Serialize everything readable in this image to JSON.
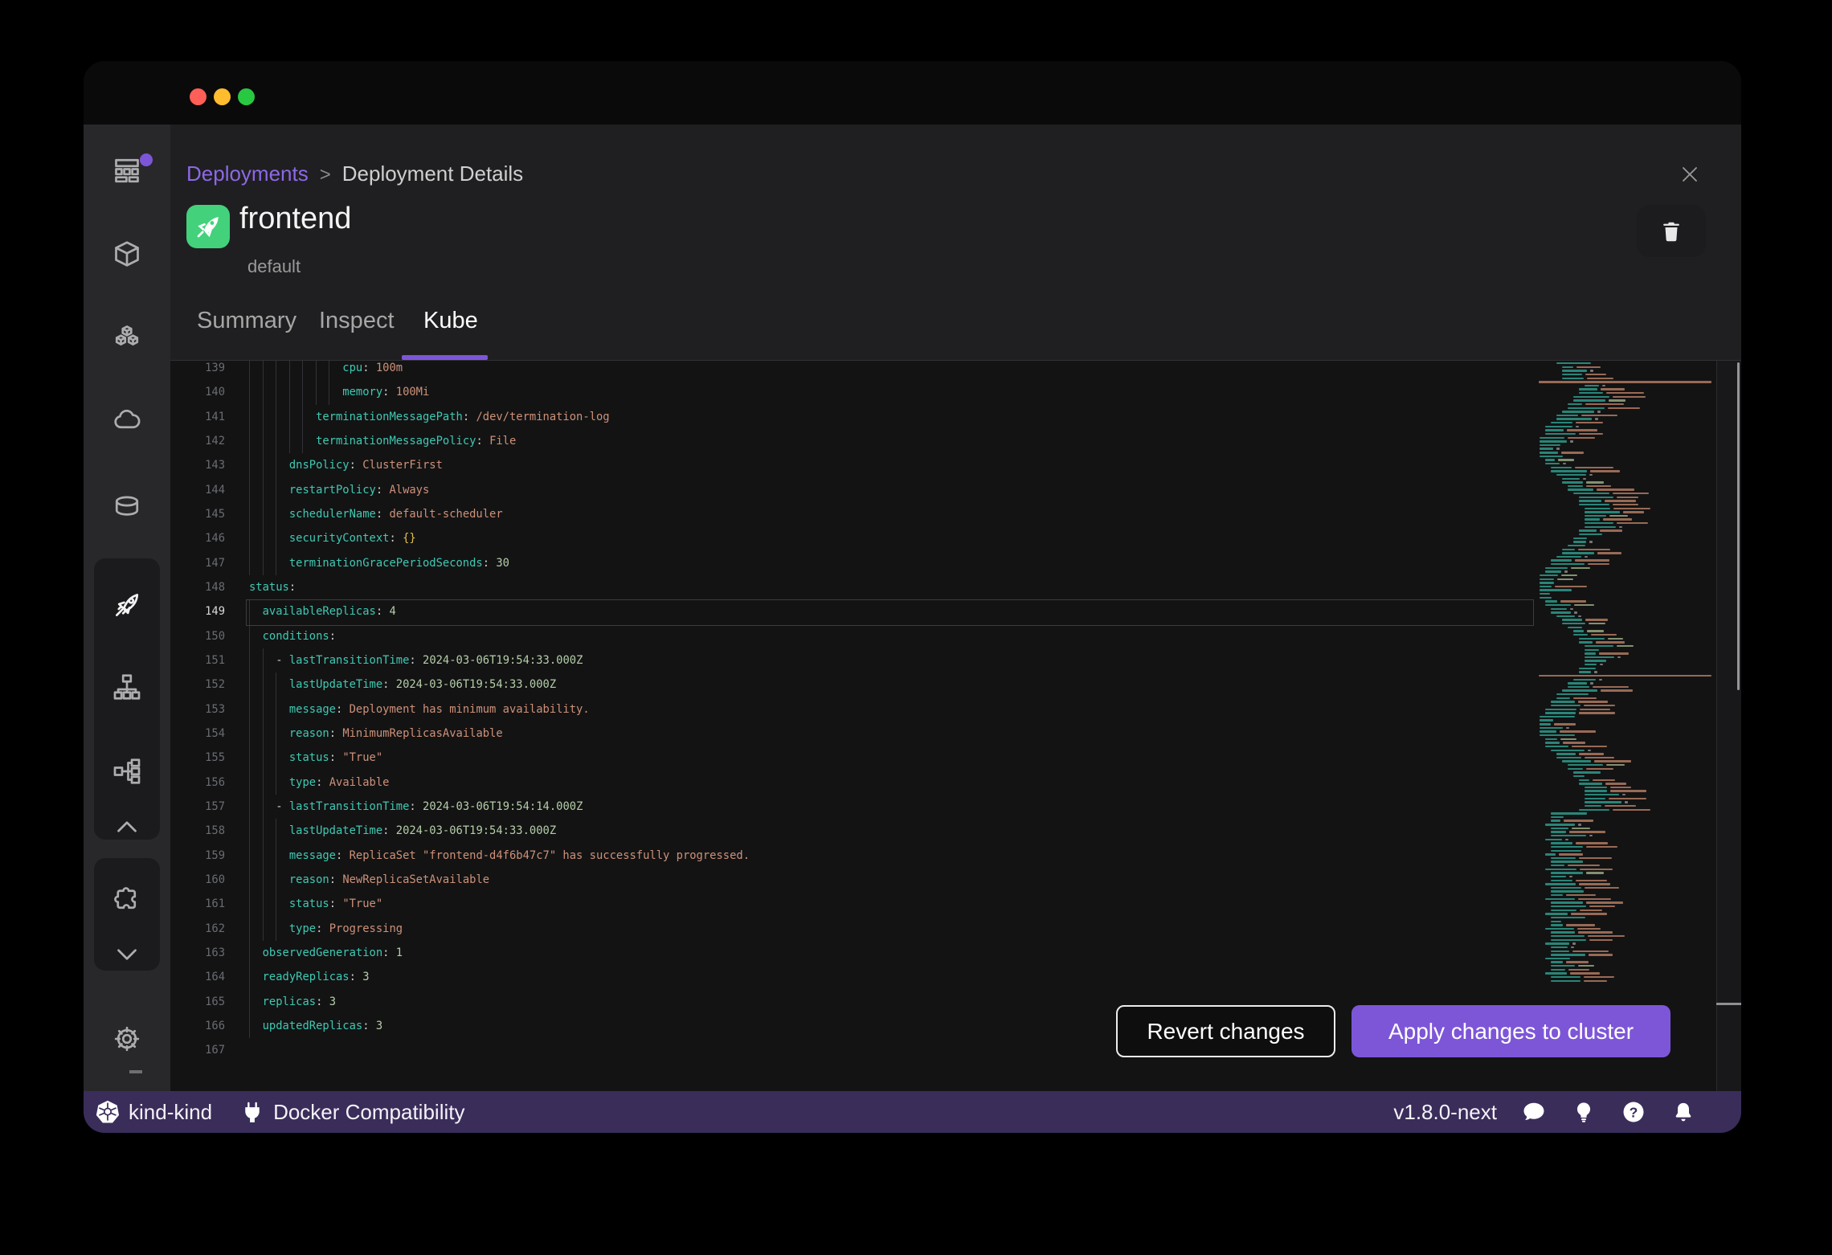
{
  "window": {
    "controls": [
      "close",
      "minimize",
      "zoom"
    ]
  },
  "header": {
    "breadcrumb": {
      "parent": "Deployments",
      "separator": ">",
      "current": "Deployment Details"
    },
    "title": "frontend",
    "namespace": "default",
    "tabs": [
      {
        "label": "Summary",
        "active": false
      },
      {
        "label": "Inspect",
        "active": false
      },
      {
        "label": "Kube",
        "active": true
      }
    ]
  },
  "sidebar": {
    "items": [
      "dashboard",
      "containers",
      "pods",
      "images-cloud",
      "volumes",
      "deployments-rocket",
      "services-sitemap",
      "networking-workflow",
      "scroll-up",
      "extensions-puzzle",
      "scroll-down",
      "settings"
    ]
  },
  "editor": {
    "first_line": 139,
    "last_line": 167,
    "current_line": 149,
    "lines": [
      {
        "n": 139,
        "ind": 14,
        "seg": [
          [
            "k",
            "cpu"
          ],
          [
            "p",
            ": "
          ],
          [
            "s",
            "100m"
          ]
        ]
      },
      {
        "n": 140,
        "ind": 14,
        "seg": [
          [
            "k",
            "memory"
          ],
          [
            "p",
            ": "
          ],
          [
            "s",
            "100Mi"
          ]
        ]
      },
      {
        "n": 141,
        "ind": 10,
        "seg": [
          [
            "k",
            "terminationMessagePath"
          ],
          [
            "p",
            ": "
          ],
          [
            "s",
            "/dev/termination-log"
          ]
        ]
      },
      {
        "n": 142,
        "ind": 10,
        "seg": [
          [
            "k",
            "terminationMessagePolicy"
          ],
          [
            "p",
            ": "
          ],
          [
            "s",
            "File"
          ]
        ]
      },
      {
        "n": 143,
        "ind": 6,
        "seg": [
          [
            "k",
            "dnsPolicy"
          ],
          [
            "p",
            ": "
          ],
          [
            "s",
            "ClusterFirst"
          ]
        ]
      },
      {
        "n": 144,
        "ind": 6,
        "seg": [
          [
            "k",
            "restartPolicy"
          ],
          [
            "p",
            ": "
          ],
          [
            "s",
            "Always"
          ]
        ]
      },
      {
        "n": 145,
        "ind": 6,
        "seg": [
          [
            "k",
            "schedulerName"
          ],
          [
            "p",
            ": "
          ],
          [
            "s",
            "default-scheduler"
          ]
        ]
      },
      {
        "n": 146,
        "ind": 6,
        "seg": [
          [
            "k",
            "securityContext"
          ],
          [
            "p",
            ": "
          ],
          [
            "b",
            "{}"
          ]
        ]
      },
      {
        "n": 147,
        "ind": 6,
        "seg": [
          [
            "k",
            "terminationGracePeriodSeconds"
          ],
          [
            "p",
            ": "
          ],
          [
            "n",
            "30"
          ]
        ]
      },
      {
        "n": 148,
        "ind": 0,
        "seg": [
          [
            "k",
            "status"
          ],
          [
            "p",
            ":"
          ]
        ]
      },
      {
        "n": 149,
        "ind": 2,
        "seg": [
          [
            "k",
            "availableReplicas"
          ],
          [
            "p",
            ": "
          ],
          [
            "n",
            "4"
          ]
        ]
      },
      {
        "n": 150,
        "ind": 2,
        "seg": [
          [
            "k",
            "conditions"
          ],
          [
            "p",
            ":"
          ]
        ]
      },
      {
        "n": 151,
        "ind": 4,
        "seg": [
          [
            "p",
            "- "
          ],
          [
            "k",
            "lastTransitionTime"
          ],
          [
            "p",
            ": "
          ],
          [
            "n",
            "2024-03-06T19:54:33.000Z"
          ]
        ]
      },
      {
        "n": 152,
        "ind": 6,
        "seg": [
          [
            "k",
            "lastUpdateTime"
          ],
          [
            "p",
            ": "
          ],
          [
            "n",
            "2024-03-06T19:54:33.000Z"
          ]
        ]
      },
      {
        "n": 153,
        "ind": 6,
        "seg": [
          [
            "k",
            "message"
          ],
          [
            "p",
            ": "
          ],
          [
            "s",
            "Deployment has minimum availability."
          ]
        ]
      },
      {
        "n": 154,
        "ind": 6,
        "seg": [
          [
            "k",
            "reason"
          ],
          [
            "p",
            ": "
          ],
          [
            "s",
            "MinimumReplicasAvailable"
          ]
        ]
      },
      {
        "n": 155,
        "ind": 6,
        "seg": [
          [
            "k",
            "status"
          ],
          [
            "p",
            ": "
          ],
          [
            "s",
            "\"True\""
          ]
        ]
      },
      {
        "n": 156,
        "ind": 6,
        "seg": [
          [
            "k",
            "type"
          ],
          [
            "p",
            ": "
          ],
          [
            "s",
            "Available"
          ]
        ]
      },
      {
        "n": 157,
        "ind": 4,
        "seg": [
          [
            "p",
            "- "
          ],
          [
            "k",
            "lastTransitionTime"
          ],
          [
            "p",
            ": "
          ],
          [
            "n",
            "2024-03-06T19:54:14.000Z"
          ]
        ]
      },
      {
        "n": 158,
        "ind": 6,
        "seg": [
          [
            "k",
            "lastUpdateTime"
          ],
          [
            "p",
            ": "
          ],
          [
            "n",
            "2024-03-06T19:54:33.000Z"
          ]
        ]
      },
      {
        "n": 159,
        "ind": 6,
        "seg": [
          [
            "k",
            "message"
          ],
          [
            "p",
            ": "
          ],
          [
            "s",
            "ReplicaSet \"frontend-d4f6b47c7\" has successfully progressed."
          ]
        ]
      },
      {
        "n": 160,
        "ind": 6,
        "seg": [
          [
            "k",
            "reason"
          ],
          [
            "p",
            ": "
          ],
          [
            "s",
            "NewReplicaSetAvailable"
          ]
        ]
      },
      {
        "n": 161,
        "ind": 6,
        "seg": [
          [
            "k",
            "status"
          ],
          [
            "p",
            ": "
          ],
          [
            "s",
            "\"True\""
          ]
        ]
      },
      {
        "n": 162,
        "ind": 6,
        "seg": [
          [
            "k",
            "type"
          ],
          [
            "p",
            ": "
          ],
          [
            "s",
            "Progressing"
          ]
        ]
      },
      {
        "n": 163,
        "ind": 2,
        "seg": [
          [
            "k",
            "observedGeneration"
          ],
          [
            "p",
            ": "
          ],
          [
            "n",
            "1"
          ]
        ]
      },
      {
        "n": 164,
        "ind": 2,
        "seg": [
          [
            "k",
            "readyReplicas"
          ],
          [
            "p",
            ": "
          ],
          [
            "n",
            "3"
          ]
        ]
      },
      {
        "n": 165,
        "ind": 2,
        "seg": [
          [
            "k",
            "replicas"
          ],
          [
            "p",
            ": "
          ],
          [
            "n",
            "3"
          ]
        ]
      },
      {
        "n": 166,
        "ind": 2,
        "seg": [
          [
            "k",
            "updatedReplicas"
          ],
          [
            "p",
            ": "
          ],
          [
            "n",
            "3"
          ]
        ]
      },
      {
        "n": 167,
        "ind": 0,
        "seg": []
      }
    ],
    "minimap": {
      "rows": 167,
      "row_height": 4.63,
      "long_rows": [
        5,
        84
      ]
    }
  },
  "actions": {
    "revert_label": "Revert changes",
    "apply_label": "Apply changes to cluster"
  },
  "statusbar": {
    "cluster": "kind-kind",
    "compatibility": "Docker Compatibility",
    "version": "v1.8.0-next"
  },
  "colors": {
    "accent": "#7d56d8",
    "accent_light": "#8d68e6",
    "brand_green": "#43d17c",
    "statusbar_bg": "#3a2d5a",
    "traffic_lights": [
      "#ff5f57",
      "#febc2e",
      "#29c841"
    ],
    "syntax": {
      "key": "#3fc9b2",
      "string": "#ce9178",
      "number": "#b5cea8",
      "punctuation": "#cfcfcf",
      "bracket": "#dfc04a"
    }
  }
}
